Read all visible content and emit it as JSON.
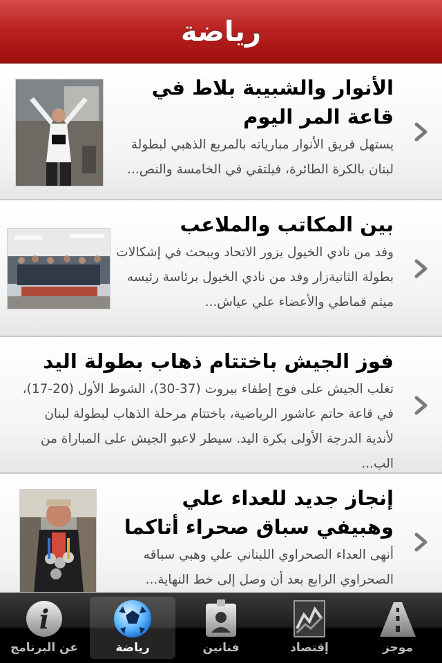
{
  "nav": {
    "title": "رياضة"
  },
  "articles": [
    {
      "title": "الأنوار والشبيبة بلاط في قاعة المر اليوم",
      "summary": "يستهل فريق الأنوار مبارياته بالمربع الذهبي لبطولة لبنان بالكرة الطائرة، فيلتقي في الخامسة والنص..."
    },
    {
      "title": "بين المكاتب والملاعب",
      "summary": "وفد من نادي الخيول يزور الاتحاد ويبحث في إشكالات بطولة الثانيةزار وفد من نادي الخيول برئاسة رئيسه ميثم قماطي والأعضاء علي عياش..."
    },
    {
      "title": "فوز الجيش باختتام ذهاب بطولة اليد",
      "summary": "تغلب الجيش على فوج إطفاء بيروت (37-30)، الشوط الأول (20-17)، في قاعة حاتم عاشور الرياضية، باختتام مرحلة الذهاب لبطولة لبنان لأندية الدرجة الأولى بكرة اليد. سيطر لاعبو الجيش على المباراة من الب..."
    },
    {
      "title": "إنجاز جديد للعداء علي وهبيفي سباق صحراء أتاكما",
      "summary": "أنهى العداء الصحراوي اللبناني علي وهبي سباقه الصحراوي الرابع بعد أن وصل إلى خط النهاية..."
    }
  ],
  "tabs": [
    {
      "label": "عن البرنامج",
      "icon": "info-icon"
    },
    {
      "label": "رياضة",
      "icon": "soccer-ball-icon",
      "active": true
    },
    {
      "label": "فنانين",
      "icon": "id-badge-icon"
    },
    {
      "label": "إقتصاد",
      "icon": "stock-chart-icon"
    },
    {
      "label": "موجز",
      "icon": "road-icon"
    }
  ],
  "colors": {
    "navbar": "#b82020",
    "tabbar": "#1c1c1c"
  }
}
